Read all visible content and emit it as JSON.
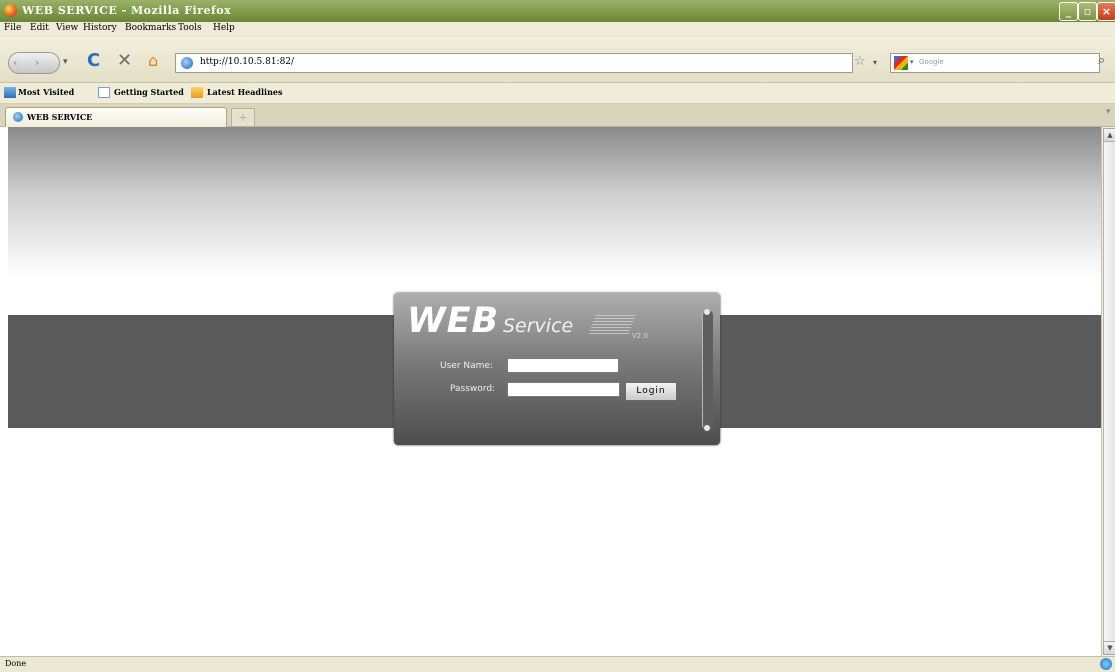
{
  "window": {
    "title": "WEB SERVICE - Mozilla Firefox"
  },
  "window_controls": {
    "minimize": "_",
    "maximize": "▫",
    "close": "×"
  },
  "menu": {
    "items": [
      "File",
      "Edit",
      "View",
      "History",
      "Bookmarks",
      "Tools",
      "Help"
    ]
  },
  "nav": {
    "back": "‹",
    "forward": "›",
    "reload": "C",
    "stop": "✕",
    "home": "⌂",
    "url": "http://10.10.5.81:82/",
    "search_placeholder": "Google"
  },
  "bookmarks": [
    "Most Visited",
    "Getting Started",
    "Latest Headlines"
  ],
  "tabs": [
    {
      "label": "WEB SERVICE"
    }
  ],
  "new_tab": "+",
  "login": {
    "logo_main": "WEB",
    "logo_sub": "Service",
    "logo_version": "V2.0",
    "username_label": "User Name:",
    "password_label": "Password:",
    "login_button": "Login"
  },
  "status": {
    "text": "Done"
  },
  "colors": {
    "title_bar": "#7f9a48",
    "band": "#5a5a5a",
    "panel": "#6e6e6e"
  },
  "icons": {
    "app": "firefox-icon",
    "reload": "reload-icon",
    "stop": "stop-icon",
    "home": "home-icon",
    "bookmark_star": "star-icon",
    "search": "magnifier-icon"
  }
}
